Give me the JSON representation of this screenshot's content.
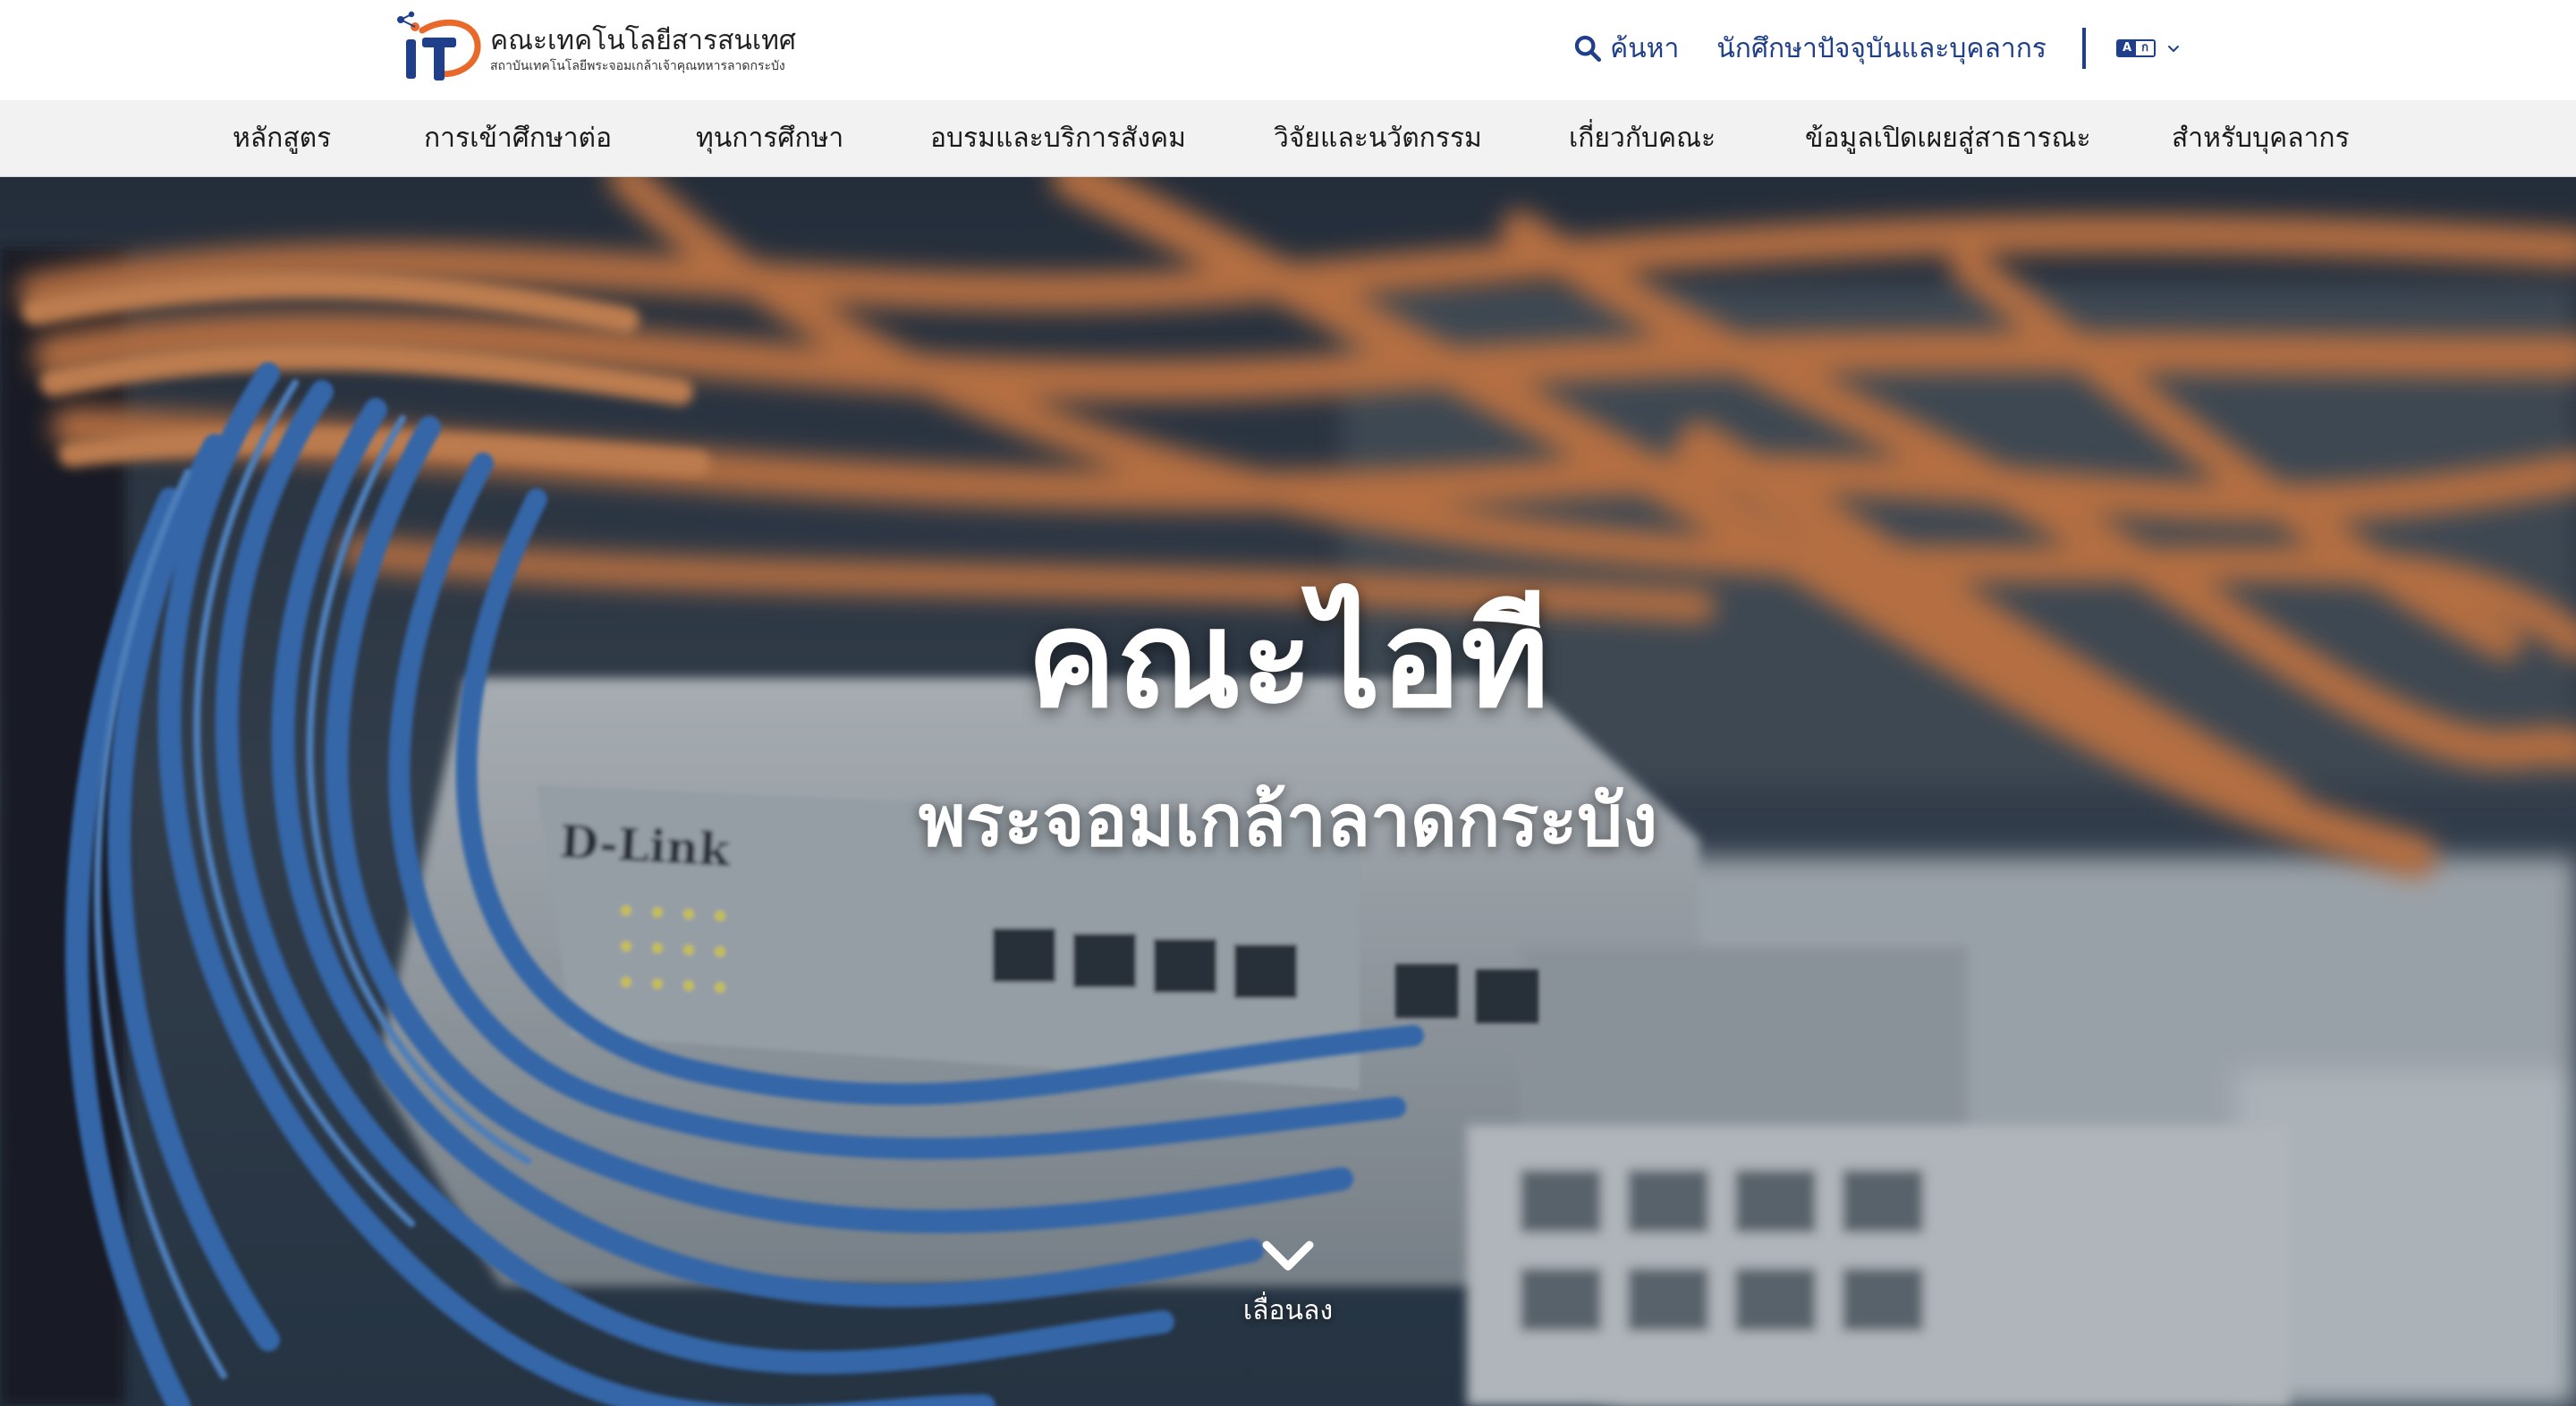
{
  "header": {
    "logo_title": "คณะเทคโนโลยีสารสนเทศ",
    "logo_subtitle": "สถาบันเทคโนโลยีพระจอมเกล้าเจ้าคุณทหารลาดกระบัง",
    "search_label": "ค้นหา",
    "students_link": "นักศึกษาปัจจุบันและบุคลากร",
    "language_icon": "translate-icon",
    "colors": {
      "brand_blue": "#1f3f8a",
      "brand_orange": "#e8692a"
    }
  },
  "nav": {
    "items": [
      {
        "label": "หลักสูตร"
      },
      {
        "label": "การเข้าศึกษาต่อ"
      },
      {
        "label": "ทุนการศึกษา"
      },
      {
        "label": "อบรมและบริการสังคม"
      },
      {
        "label": "วิจัยและนวัตกรรม"
      },
      {
        "label": "เกี่ยวกับคณะ"
      },
      {
        "label": "ข้อมูลเปิดเผยสู่สาธารณะ"
      },
      {
        "label": "สำหรับบุคลากร"
      }
    ]
  },
  "hero": {
    "title": "คณะไอที",
    "subtitle": "พระจอมเกล้าลาดกระบัง",
    "scroll_label": "เลื่อนลง",
    "background_subject": "network-switch-cables-photo"
  }
}
